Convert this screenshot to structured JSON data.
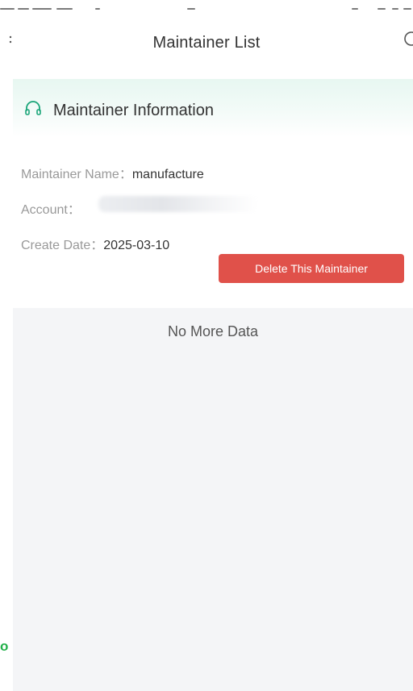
{
  "header": {
    "title": "Maintainer List",
    "back_icon": "back-chevron-icon",
    "right_icon": "more-circle-icon"
  },
  "card": {
    "title": "Maintainer Information",
    "icon": "headset-icon",
    "fields": {
      "name_label": "Maintainer Name：",
      "name_value": "manufacture",
      "account_label": "Account：",
      "date_label": "Create Date：",
      "date_value": "2025-03-10"
    },
    "delete_button": "Delete This Maintainer"
  },
  "footer_text": "No More Data",
  "overlay_text": "o",
  "colors": {
    "accent_green": "#22b04a",
    "danger": "#e0514a",
    "page_bg": "#f4f5f7",
    "header_gradient": "#e7f7f1"
  }
}
